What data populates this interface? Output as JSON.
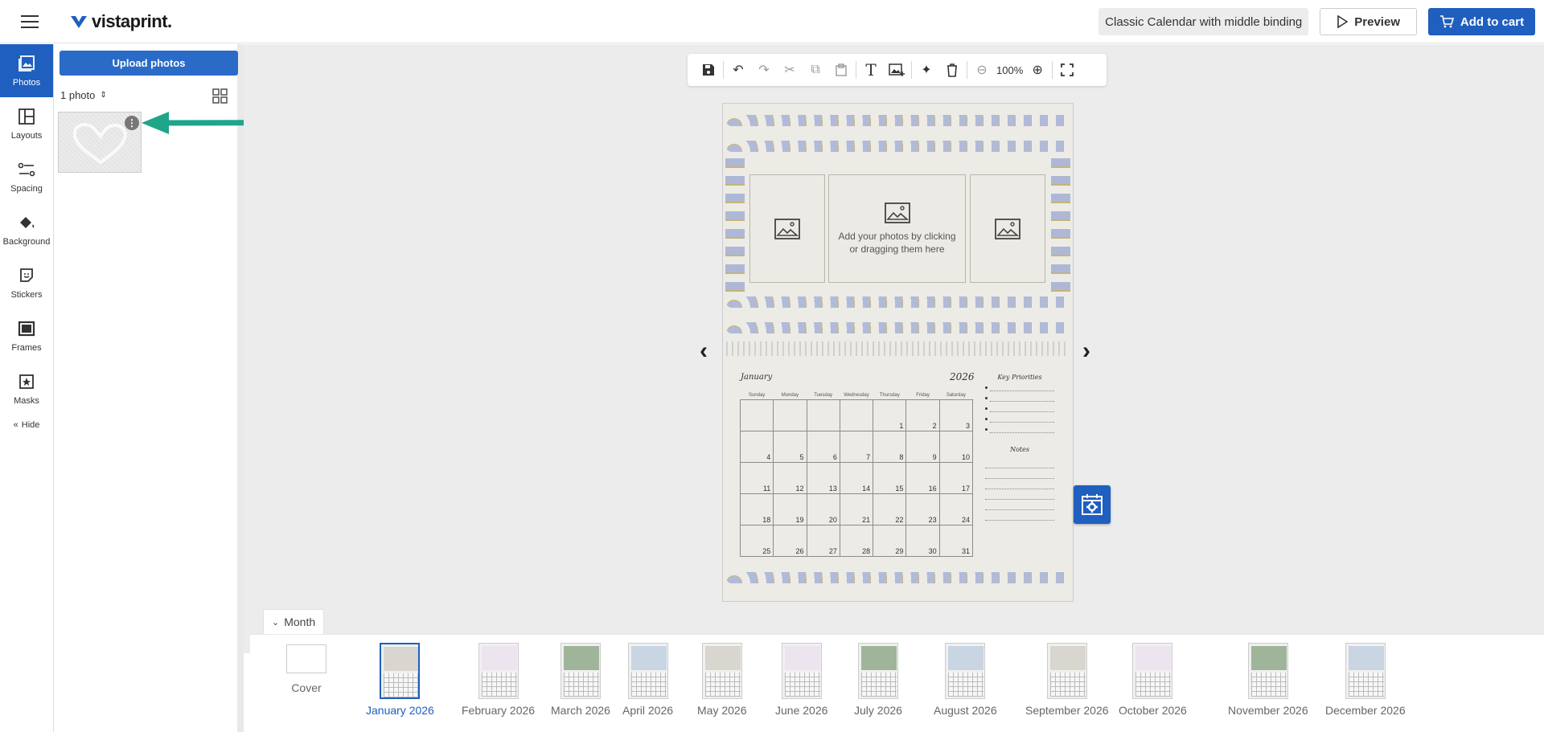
{
  "header": {
    "brand": "vistaprint.",
    "product_name": "Classic Calendar with middle binding",
    "preview_label": "Preview",
    "cart_label": "Add to cart",
    "accent_color": "#1f5fbf"
  },
  "rail": {
    "items": [
      {
        "label": "Photos",
        "icon": "photos-icon",
        "active": true
      },
      {
        "label": "Layouts",
        "icon": "layouts-icon"
      },
      {
        "label": "Spacing",
        "icon": "spacing-icon"
      },
      {
        "label": "Background",
        "icon": "paint-bucket-icon"
      },
      {
        "label": "Stickers",
        "icon": "sticker-icon"
      },
      {
        "label": "Frames",
        "icon": "frame-icon"
      },
      {
        "label": "Masks",
        "icon": "mask-icon"
      }
    ],
    "hide_label": "Hide"
  },
  "panel": {
    "upload_label": "Upload photos",
    "photo_count": "1 photo"
  },
  "toolbar": {
    "zoom": "100%",
    "icons": [
      "save-icon",
      "undo-icon",
      "redo-icon",
      "cut-icon",
      "copy-icon",
      "paste-icon",
      "text-icon",
      "add-image-icon",
      "magic-wand-icon",
      "delete-icon",
      "zoom-out-icon",
      "zoom-in-icon",
      "fullscreen-icon"
    ]
  },
  "page": {
    "slot_hint": "Add your photos by clicking or dragging them here",
    "month": "January",
    "year": "2026",
    "weekdays": [
      "Sunday",
      "Monday",
      "Tuesday",
      "Wednesday",
      "Thursday",
      "Friday",
      "Saturday"
    ],
    "weeks": [
      [
        "",
        "",
        "",
        "",
        "1",
        "2",
        "3"
      ],
      [
        "4",
        "5",
        "6",
        "7",
        "8",
        "9",
        "10"
      ],
      [
        "11",
        "12",
        "13",
        "14",
        "15",
        "16",
        "17"
      ],
      [
        "18",
        "19",
        "20",
        "21",
        "22",
        "23",
        "24"
      ],
      [
        "25",
        "26",
        "27",
        "28",
        "29",
        "30",
        "31"
      ]
    ],
    "key_priorities_title": "Key Priorities",
    "notes_title": "Notes"
  },
  "month_strip": {
    "tab_label": "Month",
    "items": [
      {
        "label": "Cover",
        "type": "cover"
      },
      {
        "label": "January 2026",
        "active": true,
        "top": "#d8d6cf"
      },
      {
        "label": "February 2026",
        "top": "#ece4ee"
      },
      {
        "label": "March 2026",
        "top": "#9fb59a"
      },
      {
        "label": "April 2026",
        "top": "#c9d5e3"
      },
      {
        "label": "May 2026",
        "top": "#d8d6cf"
      },
      {
        "label": "June 2026",
        "top": "#ece4ee"
      },
      {
        "label": "July 2026",
        "top": "#9fb59a"
      },
      {
        "label": "August 2026",
        "top": "#c9d5e3"
      },
      {
        "label": "September 2026",
        "top": "#d8d6cf"
      },
      {
        "label": "October 2026",
        "top": "#ece4ee"
      },
      {
        "label": "November 2026",
        "top": "#9fb59a"
      },
      {
        "label": "December 2026",
        "top": "#c9d5e3"
      }
    ]
  }
}
